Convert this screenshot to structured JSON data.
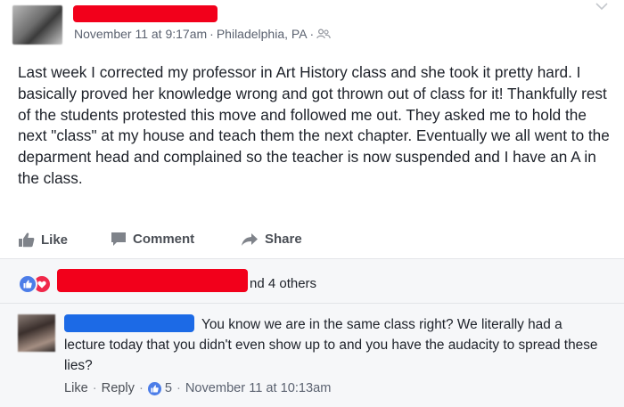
{
  "post": {
    "author_name": "",
    "timestamp": "November 11 at 9:17am",
    "location": "Philadelphia, PA",
    "separator": "·",
    "audience_icon": "friends-icon",
    "body": "Last week I corrected my professor in Art History class and she took it pretty hard. I basically proved her knowledge wrong and got thrown out of class for it! Thankfully rest of the students protested this move and followed me out. They asked me to hold the next \"class\" at my house and teach them the next chapter. Eventually we all went to the deparment head and complained so the teacher is now suspended and I have an A in the class."
  },
  "actions": {
    "like_label": "Like",
    "comment_label": "Comment",
    "share_label": "Share"
  },
  "reactions": {
    "icons": [
      "like-reaction-icon",
      "love-reaction-icon"
    ],
    "summary": "nd 4 others"
  },
  "comment": {
    "text": "You know we are in the same class right? We literally had a lecture today that you didn't even show up to and you have the audacity to spread these lies?",
    "like_label": "Like",
    "reply_label": "Reply",
    "like_count": "5",
    "timestamp": "November 11 at 10:13am",
    "separator": "·"
  },
  "colors": {
    "redaction_red": "#f2001b",
    "redaction_blue": "#1c6ae6",
    "like_blue": "#4c7de8",
    "love_red": "#f0284a"
  }
}
